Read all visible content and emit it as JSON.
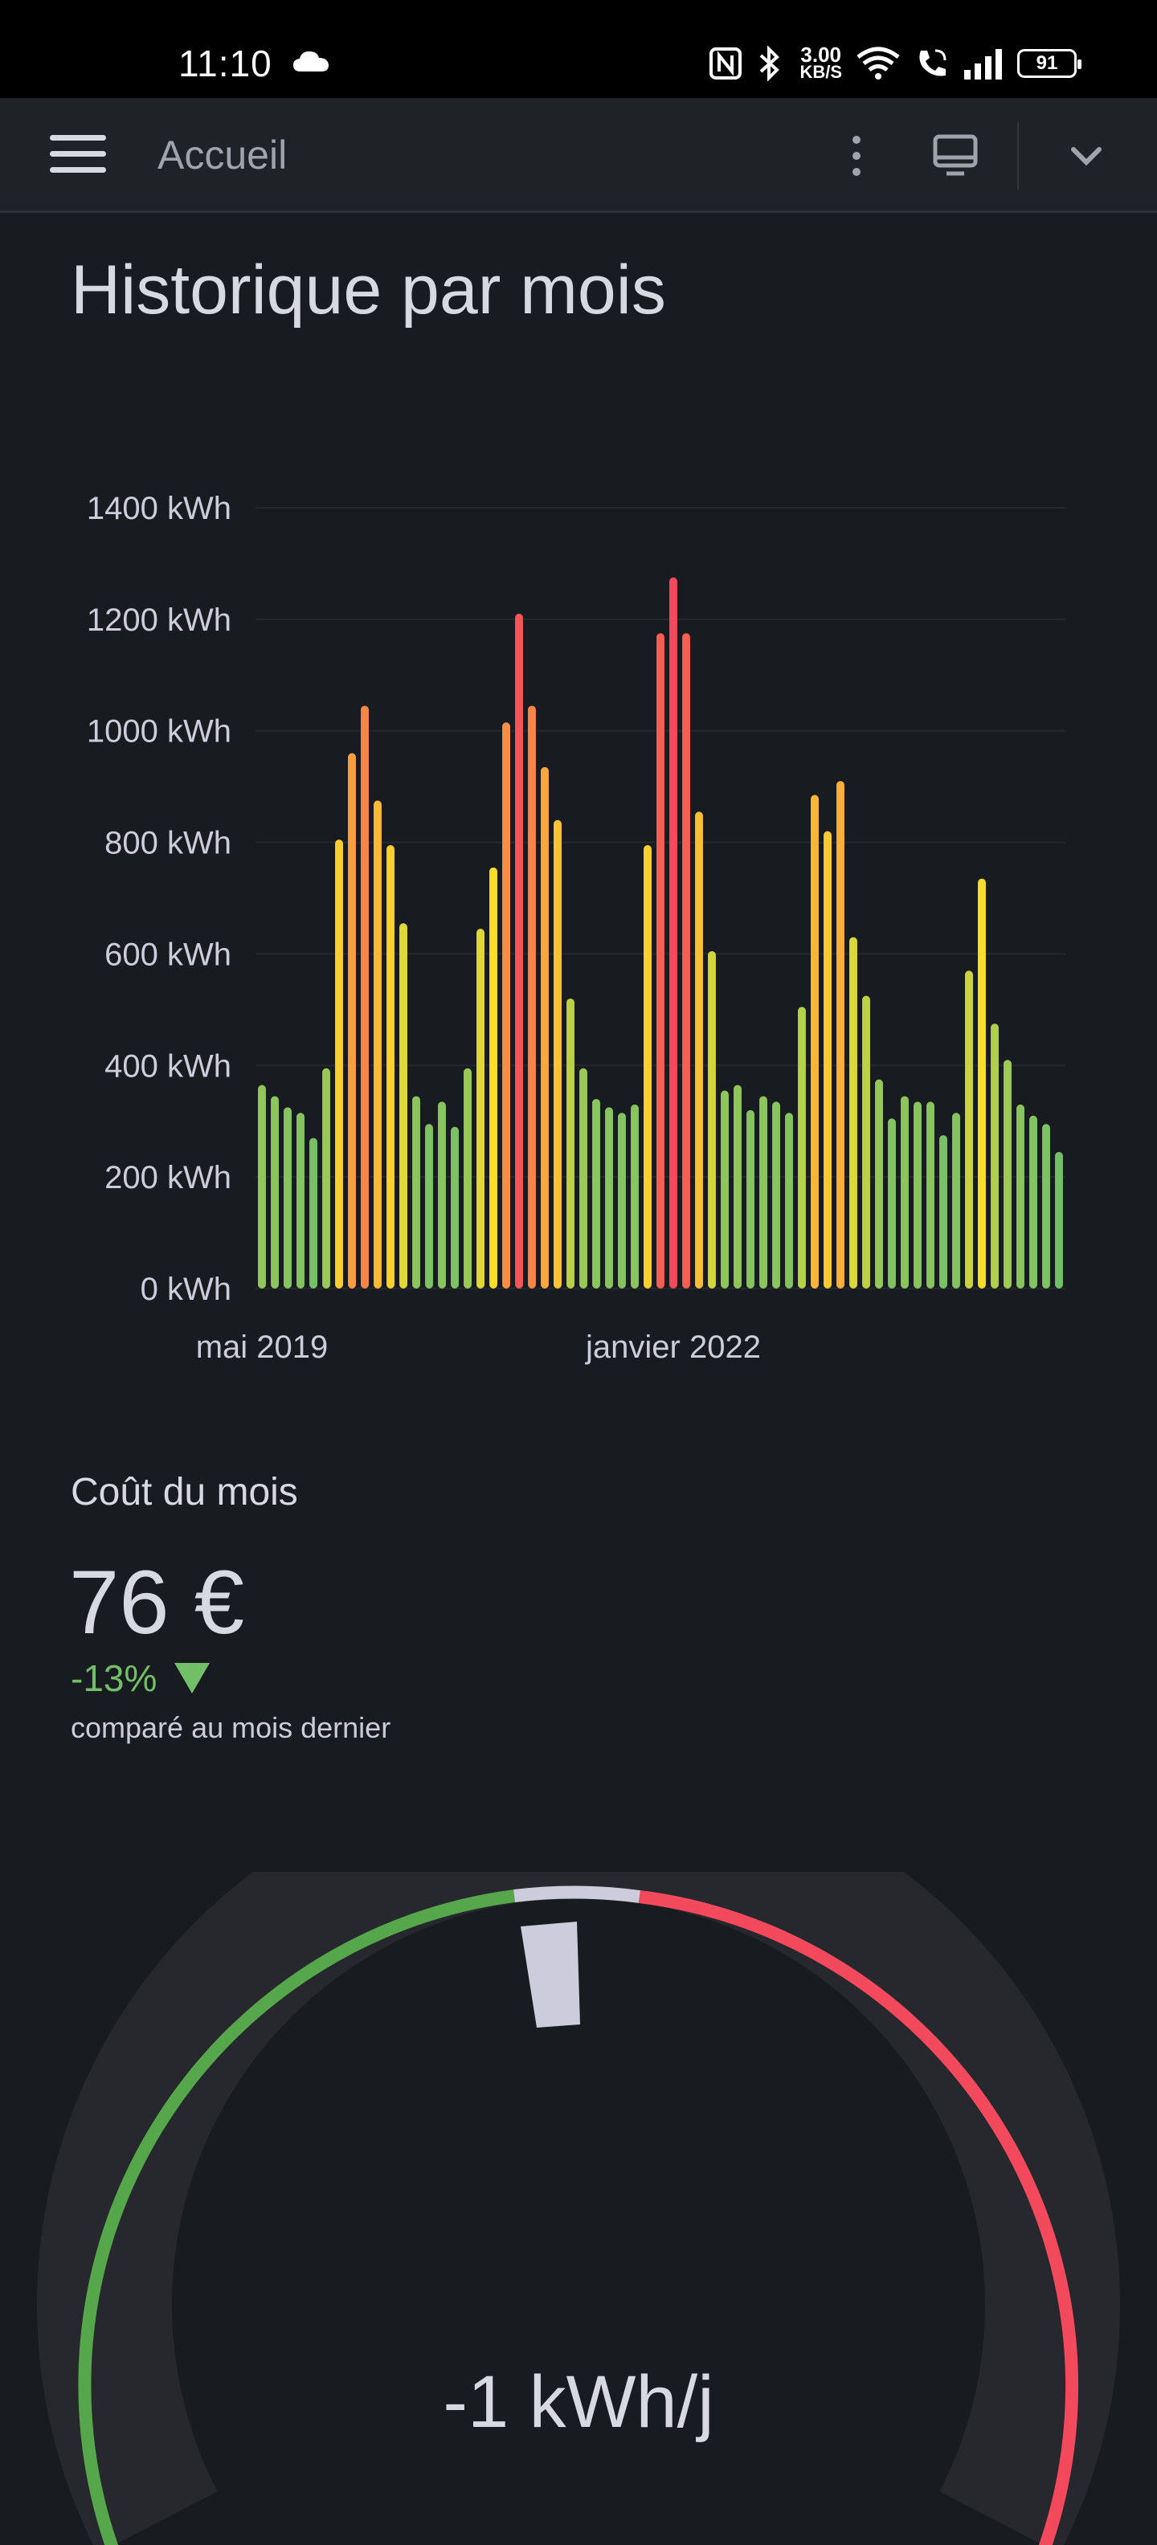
{
  "status_bar": {
    "time": "11:10",
    "net_speed_value": "3.00",
    "net_speed_unit": "KB/S",
    "battery": "91",
    "icons": [
      "cloud-icon",
      "nfc-icon",
      "bluetooth-icon",
      "wifi-icon",
      "wifi-call-icon",
      "signal-icon",
      "battery-icon"
    ]
  },
  "topbar": {
    "breadcrumb": "Accueil",
    "icons": [
      "menu-icon",
      "kebab-menu-icon",
      "monitor-icon",
      "chevron-down-icon"
    ]
  },
  "panel": {
    "title": "Historique par mois"
  },
  "chart_data": {
    "type": "bar",
    "title": "Historique par mois",
    "xlabel": "",
    "ylabel": "",
    "unit": "kWh",
    "ylim": [
      0,
      1400
    ],
    "yticks": [
      "0 kWh",
      "200 kWh",
      "400 kWh",
      "600 kWh",
      "800 kWh",
      "1000 kWh",
      "1200 kWh",
      "1400 kWh"
    ],
    "xtick_labels": [
      {
        "label": "mai 2019",
        "index": 0
      },
      {
        "label": "janvier 2022",
        "index": 32
      }
    ],
    "grid": true,
    "legend": "none",
    "color_scale": {
      "low": "#73bf69",
      "mid": "#fade2a",
      "high": "#f2495c"
    },
    "values": [
      365,
      345,
      325,
      315,
      270,
      395,
      805,
      960,
      1045,
      875,
      795,
      655,
      345,
      295,
      335,
      290,
      395,
      645,
      755,
      1015,
      1210,
      1045,
      935,
      840,
      520,
      395,
      340,
      325,
      315,
      330,
      795,
      1175,
      1275,
      1175,
      855,
      605,
      355,
      365,
      320,
      345,
      335,
      315,
      505,
      885,
      820,
      910,
      630,
      525,
      375,
      305,
      345,
      335,
      335,
      275,
      315,
      570,
      735,
      475,
      410,
      330,
      310,
      295,
      245
    ]
  },
  "stat": {
    "title": "Coût du mois",
    "value": "76 €",
    "delta": "-13%",
    "subtitle": "comparé au mois dernier",
    "delta_color": "#73bf69"
  },
  "gauge": {
    "value_text": "-1 kWh/j",
    "value": -1,
    "colors": {
      "low": "#56a64b",
      "neutral": "#ccccdc",
      "high": "#f2495c"
    }
  }
}
